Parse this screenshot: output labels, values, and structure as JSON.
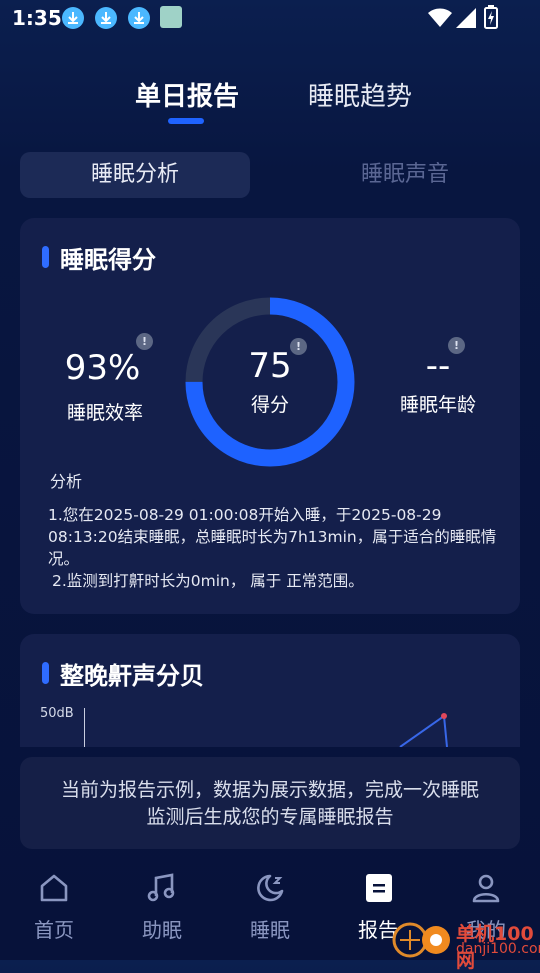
{
  "status_bar": {
    "time": "1:35"
  },
  "top_tabs": {
    "daily_report": "单日报告",
    "sleep_trend": "睡眠趋势"
  },
  "segment": {
    "analysis": "睡眠分析",
    "sound": "睡眠声音"
  },
  "score_card": {
    "title": "睡眠得分",
    "efficiency_value": "93%",
    "efficiency_label": "睡眠效率",
    "score_value": "75",
    "score_label": "得分",
    "score_fraction": 0.75,
    "age_value": "--",
    "age_label": "睡眠年龄",
    "analysis_title": "分析",
    "analysis_line1": "1.您在2025-08-29 01:00:08开始入睡，于2025-08-29 08:13:20结束睡眠，总睡眠时长为7h13min，属于适合的睡眠情况。",
    "analysis_line2": "2.监测到打鼾时长为0min， 属于 正常范围。"
  },
  "snore_card": {
    "title": "整晚鼾声分贝",
    "y_label": "50dB"
  },
  "notice": {
    "text": "当前为报告示例，数据为展示数据，完成一次睡眠监测后生成您的专属睡眠报告"
  },
  "nav": {
    "home": "首页",
    "assist": "助眠",
    "sleep": "睡眠",
    "report": "报告",
    "mine": "我的"
  },
  "watermark": {
    "name": "单机100网",
    "url": "danji100.com"
  },
  "colors": {
    "accent": "#1f63ff",
    "background": "#07123a",
    "card": "#141f4b"
  }
}
